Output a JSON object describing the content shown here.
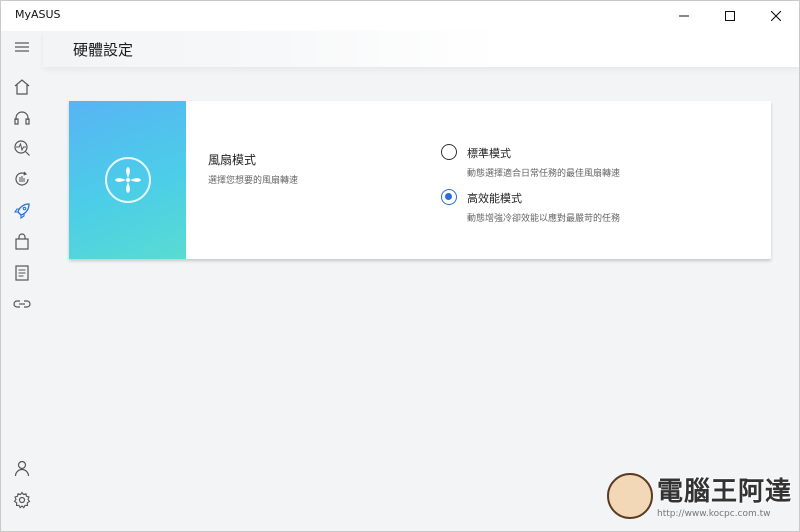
{
  "window": {
    "title": "MyASUS"
  },
  "header": {
    "title": "硬體設定"
  },
  "sidebar": {
    "items": [
      {
        "icon": "menu-icon"
      },
      {
        "icon": "home-icon"
      },
      {
        "icon": "headset-icon"
      },
      {
        "icon": "diagnostics-icon"
      },
      {
        "icon": "update-icon"
      },
      {
        "icon": "rocket-icon"
      },
      {
        "icon": "store-bag-icon"
      },
      {
        "icon": "news-icon"
      },
      {
        "icon": "link-icon"
      },
      {
        "icon": "user-icon"
      },
      {
        "icon": "settings-gear-icon"
      }
    ]
  },
  "fan_mode": {
    "title": "風扇模式",
    "description": "選擇您想要的風扇轉速",
    "options": [
      {
        "label": "標準模式",
        "description": "動態選擇適合日常任務的最佳風扇轉速",
        "selected": false
      },
      {
        "label": "高效能模式",
        "description": "動態增強冷卻效能以應對最嚴苛的任務",
        "selected": true
      }
    ]
  },
  "watermark": {
    "brand": "電腦王阿達",
    "url": "http://www.kocpc.com.tw"
  },
  "colors": {
    "accent": "#2a6fd6",
    "banner_start": "#57b4f4",
    "banner_end": "#58dcd2"
  }
}
